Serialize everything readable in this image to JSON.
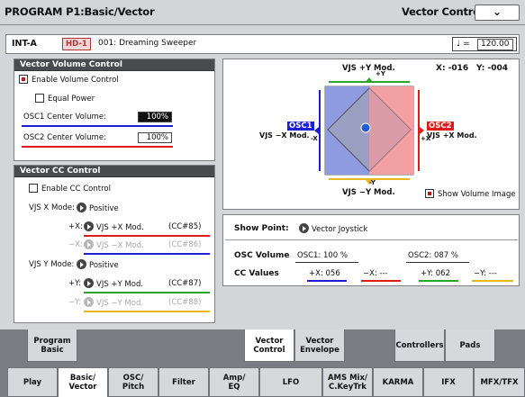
{
  "header": {
    "title": "PROGRAM P1:Basic/Vector",
    "page": "Vector Control"
  },
  "program": {
    "bank": "INT-A",
    "badge": "HD-1",
    "name": "001: Dreaming Sweeper",
    "tempo_symbol": "♩ =",
    "tempo": "120.00"
  },
  "volume": {
    "title": "Vector Volume Control",
    "enable_label": "Enable Volume Control",
    "equal_power_label": "Equal Power",
    "osc1_label": "OSC1 Center Volume:",
    "osc1_value": "100%",
    "osc2_label": "OSC2 Center Volume:",
    "osc2_value": "100%"
  },
  "cc": {
    "title": "Vector CC Control",
    "enable_label": "Enable CC Control",
    "x_mode_label": "VJS X Mode:",
    "x_mode": "Positive",
    "x_plus_label": "+X:",
    "x_plus": "VJS +X Mod.",
    "x_plus_cc": "(CC#85)",
    "x_minus_label": "−X:",
    "x_minus": "VJS −X Mod.",
    "x_minus_cc": "(CC#86)",
    "y_mode_label": "VJS Y Mode:",
    "y_mode": "Positive",
    "y_plus_label": "+Y:",
    "y_plus": "VJS +Y Mod.",
    "y_plus_cc": "(CC#87)",
    "y_minus_label": "−Y:",
    "y_minus": "VJS −Y Mod.",
    "y_minus_cc": "(CC#88)"
  },
  "vector": {
    "top_label": "VJS +Y Mod.",
    "bottom_label": "VJS −Y Mod.",
    "left_label": "VJS −X Mod.",
    "right_label": "VJS +X Mod.",
    "plus_y": "+Y",
    "minus_y": "-Y",
    "plus_x": "+X",
    "minus_x": "-X",
    "osc1": "OSC1",
    "osc2": "OSC2",
    "x_readout": "X: -016",
    "y_readout": "Y: -004",
    "show_image_label": "Show Volume Image"
  },
  "showpoint": {
    "label": "Show Point:",
    "value": "Vector Joystick"
  },
  "oscvol": {
    "label": "OSC Volume",
    "osc1": "OSC1: 100 %",
    "osc2": "OSC2: 087 %"
  },
  "ccvalues": {
    "label": "CC Values",
    "x_plus": "+X: 056",
    "x_minus": "−X: ---",
    "y_plus": "+Y: 062",
    "y_minus": "−Y: ---"
  },
  "tabs_top": [
    {
      "line1": "Program",
      "line2": "Basic"
    },
    {
      "line1": "Vector",
      "line2": "Control"
    },
    {
      "line1": "Vector",
      "line2": "Envelope"
    },
    {
      "line1": "Controllers",
      "line2": ""
    },
    {
      "line1": "Pads",
      "line2": ""
    }
  ],
  "tabs_bottom": [
    {
      "line1": "Play",
      "line2": ""
    },
    {
      "line1": "Basic/",
      "line2": "Vector"
    },
    {
      "line1": "OSC/",
      "line2": "Pitch"
    },
    {
      "line1": "Filter",
      "line2": ""
    },
    {
      "line1": "Amp/",
      "line2": "EQ"
    },
    {
      "line1": "LFO",
      "line2": ""
    },
    {
      "line1": "AMS Mix/",
      "line2": "C.KeyTrk"
    },
    {
      "line1": "KARMA",
      "line2": ""
    },
    {
      "line1": "IFX",
      "line2": ""
    },
    {
      "line1": "MFX/TFX",
      "line2": ""
    }
  ],
  "colors": {
    "osc1": "#1f1fd2",
    "osc2": "#e01b1b",
    "y_green": "#2aa52a",
    "y_yellow": "#e8b820"
  }
}
